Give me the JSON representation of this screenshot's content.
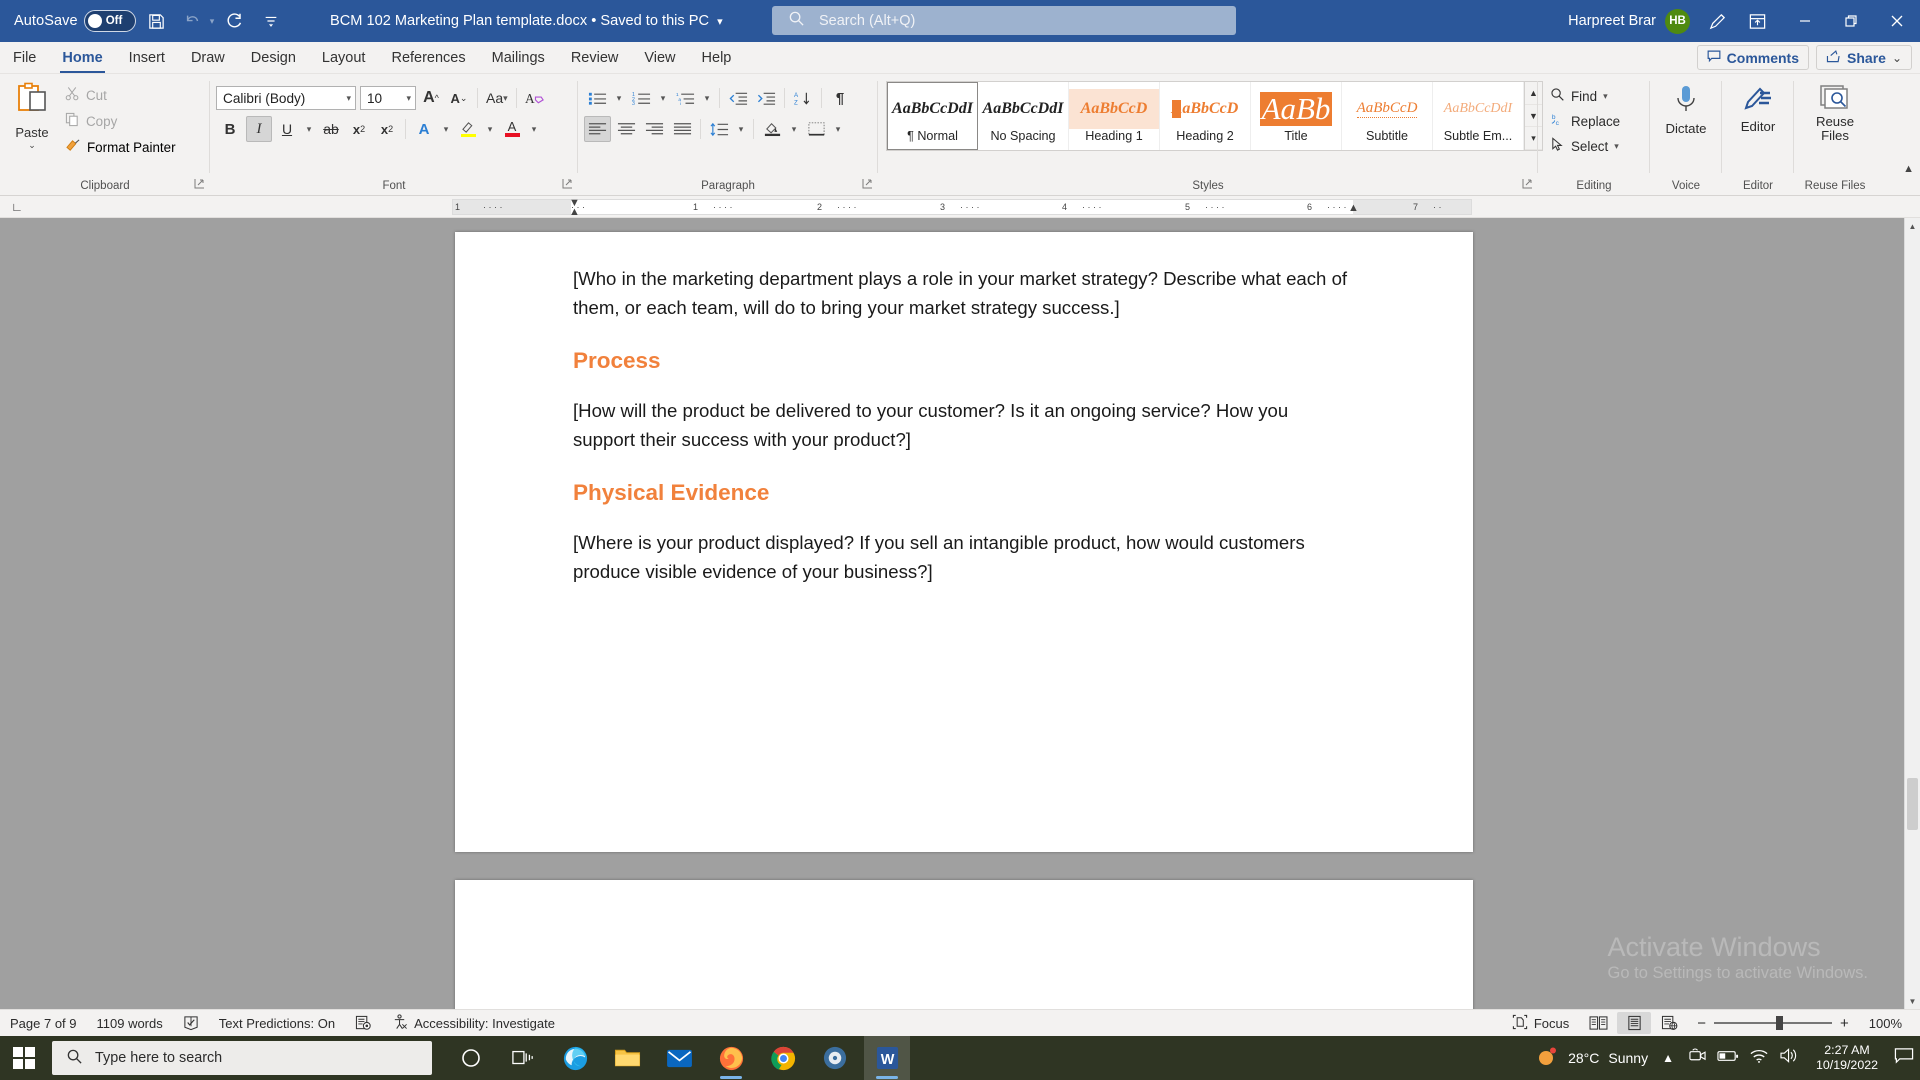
{
  "titlebar": {
    "autosave_label": "AutoSave",
    "autosave_state": "Off",
    "save_icon": "save-icon",
    "undo_icon": "undo-icon",
    "redo_icon": "redo-icon",
    "customize_icon": "customize-quick-access-icon",
    "document_title": "BCM 102 Marketing Plan template.docx • Saved to this PC",
    "title_caret": "⌄",
    "search_placeholder": "Search (Alt+Q)",
    "search_icon": "search-icon",
    "user_name": "Harpreet Brar",
    "user_initials": "HB",
    "ink_icon": "ink-pen-icon",
    "ribbon_display_icon": "ribbon-display-options-icon",
    "minimize_icon": "minimize-icon",
    "restore_icon": "restore-icon",
    "close_icon": "close-icon",
    "accent_color": "#2b579a",
    "avatar_color": "#4f8a10"
  },
  "tabs": [
    {
      "label": "File",
      "active": false
    },
    {
      "label": "Home",
      "active": true
    },
    {
      "label": "Insert",
      "active": false
    },
    {
      "label": "Draw",
      "active": false
    },
    {
      "label": "Design",
      "active": false
    },
    {
      "label": "Layout",
      "active": false
    },
    {
      "label": "References",
      "active": false
    },
    {
      "label": "Mailings",
      "active": false
    },
    {
      "label": "Review",
      "active": false
    },
    {
      "label": "View",
      "active": false
    },
    {
      "label": "Help",
      "active": false
    }
  ],
  "tab_actions": {
    "comments_label": "Comments",
    "comments_icon": "comment-icon",
    "share_label": "Share",
    "share_icon": "share-icon",
    "share_caret": "⌄"
  },
  "ribbon": {
    "clipboard": {
      "group_label": "Clipboard",
      "paste_label": "Paste",
      "paste_caret": "⌄",
      "paste_icon": "paste-icon",
      "items": [
        {
          "label": "Cut",
          "icon": "scissors-icon",
          "disabled": true
        },
        {
          "label": "Copy",
          "icon": "copy-icon",
          "disabled": true
        },
        {
          "label": "Format Painter",
          "icon": "format-painter-icon",
          "disabled": false
        }
      ],
      "launcher_icon": "dialog-launcher-icon"
    },
    "font": {
      "group_label": "Font",
      "font_family": "Calibri (Body)",
      "font_size": "10",
      "grow_icon": "increase-font-size-icon",
      "shrink_icon": "decrease-font-size-icon",
      "change_case_icon": "change-case-icon",
      "clear_formatting_icon": "clear-formatting-icon",
      "bold_icon": "bold-icon",
      "italic_icon": "italic-icon",
      "italic_active": true,
      "underline_icon": "underline-icon",
      "strikethrough_icon": "strikethrough-icon",
      "subscript_icon": "subscript-icon",
      "superscript_icon": "superscript-icon",
      "text_effects_icon": "text-effects-icon",
      "highlight_icon": "text-highlight-color-icon",
      "font_color_icon": "font-color-icon",
      "highlight_color": "#ffff00",
      "font_color": "#e81123",
      "launcher_icon": "dialog-launcher-icon"
    },
    "paragraph": {
      "group_label": "Paragraph",
      "bullets_icon": "bullets-icon",
      "numbering_icon": "numbering-icon",
      "multilevel_icon": "multilevel-list-icon",
      "decrease_indent_icon": "decrease-indent-icon",
      "increase_indent_icon": "increase-indent-icon",
      "sort_icon": "sort-icon",
      "show_marks_icon": "show-formatting-marks-icon",
      "align_left_icon": "align-left-icon",
      "align_left_active": true,
      "align_center_icon": "align-center-icon",
      "align_right_icon": "align-right-icon",
      "justify_icon": "justify-icon",
      "line_spacing_icon": "line-spacing-icon",
      "shading_icon": "shading-icon",
      "borders_icon": "borders-icon",
      "launcher_icon": "dialog-launcher-icon"
    },
    "styles": {
      "group_label": "Styles",
      "launcher_icon": "dialog-launcher-icon",
      "scroll_up_icon": "scroll-up-icon",
      "scroll_down_icon": "scroll-down-icon",
      "more_icon": "more-styles-icon",
      "items": [
        {
          "name": "¶ Normal",
          "preview": "AaBbCcDdI",
          "active": true,
          "style": "normal"
        },
        {
          "name": "No Spacing",
          "preview": "AaBbCcDdI",
          "active": false,
          "style": "nospacing"
        },
        {
          "name": "Heading 1",
          "preview": "AaBbCcD",
          "active": false,
          "style": "heading1"
        },
        {
          "name": "Heading 2",
          "preview": "AaBbCcD",
          "active": false,
          "style": "heading2"
        },
        {
          "name": "Title",
          "preview": "AaBb",
          "active": false,
          "style": "title"
        },
        {
          "name": "Subtitle",
          "preview": "AaBbCcD",
          "active": false,
          "style": "subtitle"
        },
        {
          "name": "Subtle Em...",
          "preview": "AaBbCcDdI",
          "active": false,
          "style": "subtle"
        }
      ]
    },
    "editing": {
      "group_label": "Editing",
      "items": [
        {
          "label": "Find",
          "icon": "find-icon",
          "caret": "⌄"
        },
        {
          "label": "Replace",
          "icon": "replace-icon",
          "caret": ""
        },
        {
          "label": "Select",
          "icon": "select-icon",
          "caret": "⌄"
        }
      ]
    },
    "voice": {
      "group_label": "Voice",
      "button_label": "Dictate",
      "icon": "microphone-icon"
    },
    "editor": {
      "group_label": "Editor",
      "button_label": "Editor",
      "icon": "editor-pencil-icon"
    },
    "reuse": {
      "group_label": "Reuse Files",
      "button_label": "Reuse\nFiles",
      "button_label_line1": "Reuse",
      "button_label_line2": "Files",
      "icon": "reuse-files-icon"
    },
    "collapse_icon": "collapse-ribbon-icon"
  },
  "ruler": {
    "tabstop_icon": "tab-stop-left-icon",
    "marks": [
      "1",
      "1",
      "2",
      "3",
      "4",
      "5",
      "6",
      "7"
    ]
  },
  "document": {
    "blocks": [
      {
        "type": "paragraph",
        "text": "[Who in the marketing department plays a role in your market strategy? Describe what each of them, or each team, will do to bring your market strategy success.]"
      },
      {
        "type": "heading",
        "text": "Process"
      },
      {
        "type": "paragraph",
        "text": "[How will the product be delivered to your customer? Is it an ongoing service? How you support their success with your product?]"
      },
      {
        "type": "heading",
        "text": "Physical Evidence"
      },
      {
        "type": "paragraph",
        "text": "[Where is your product displayed? If you sell an intangible product, how would customers produce visible evidence of your business?]"
      }
    ],
    "heading_color": "#f1813c"
  },
  "watermark": {
    "line1": "Activate Windows",
    "line2": "Go to Settings to activate Windows."
  },
  "statusbar": {
    "page": "Page 7 of 9",
    "words": "1109 words",
    "proofing_icon": "proofing-icon",
    "text_predictions": "Text Predictions: On",
    "predictions_icon": "text-predictions-icon",
    "accessibility_icon": "accessibility-icon",
    "accessibility": "Accessibility: Investigate",
    "focus_label": "Focus",
    "focus_icon": "focus-mode-icon",
    "read_mode_icon": "read-mode-icon",
    "print_layout_icon": "print-layout-icon",
    "web_layout_icon": "web-layout-icon",
    "zoom_out_icon": "−",
    "zoom_in_icon": "+",
    "zoom_level": "100%"
  },
  "taskbar": {
    "start_icon": "windows-start-icon",
    "search_placeholder": "Type here to search",
    "search_icon": "search-icon",
    "cortana_icon": "cortana-circle-icon",
    "taskview_icon": "task-view-icon",
    "apps": [
      {
        "name": "edge-icon",
        "open": false,
        "active": false
      },
      {
        "name": "file-explorer-icon",
        "open": false,
        "active": false
      },
      {
        "name": "mail-icon",
        "open": false,
        "active": false
      },
      {
        "name": "firefox-icon",
        "open": true,
        "active": false
      },
      {
        "name": "chrome-icon",
        "open": false,
        "active": false
      },
      {
        "name": "media-player-icon",
        "open": false,
        "active": false
      },
      {
        "name": "word-icon",
        "open": true,
        "active": true
      }
    ],
    "weather_temp": "28°C",
    "weather_desc": "Sunny",
    "weather_icon": "sunny-icon",
    "tray_expand_icon": "show-hidden-icons-icon",
    "tray_icons": [
      "meet-now-icon",
      "battery-icon",
      "wifi-icon",
      "volume-icon"
    ],
    "time": "2:27 AM",
    "date": "10/19/2022",
    "notification_icon": "notification-center-icon"
  }
}
